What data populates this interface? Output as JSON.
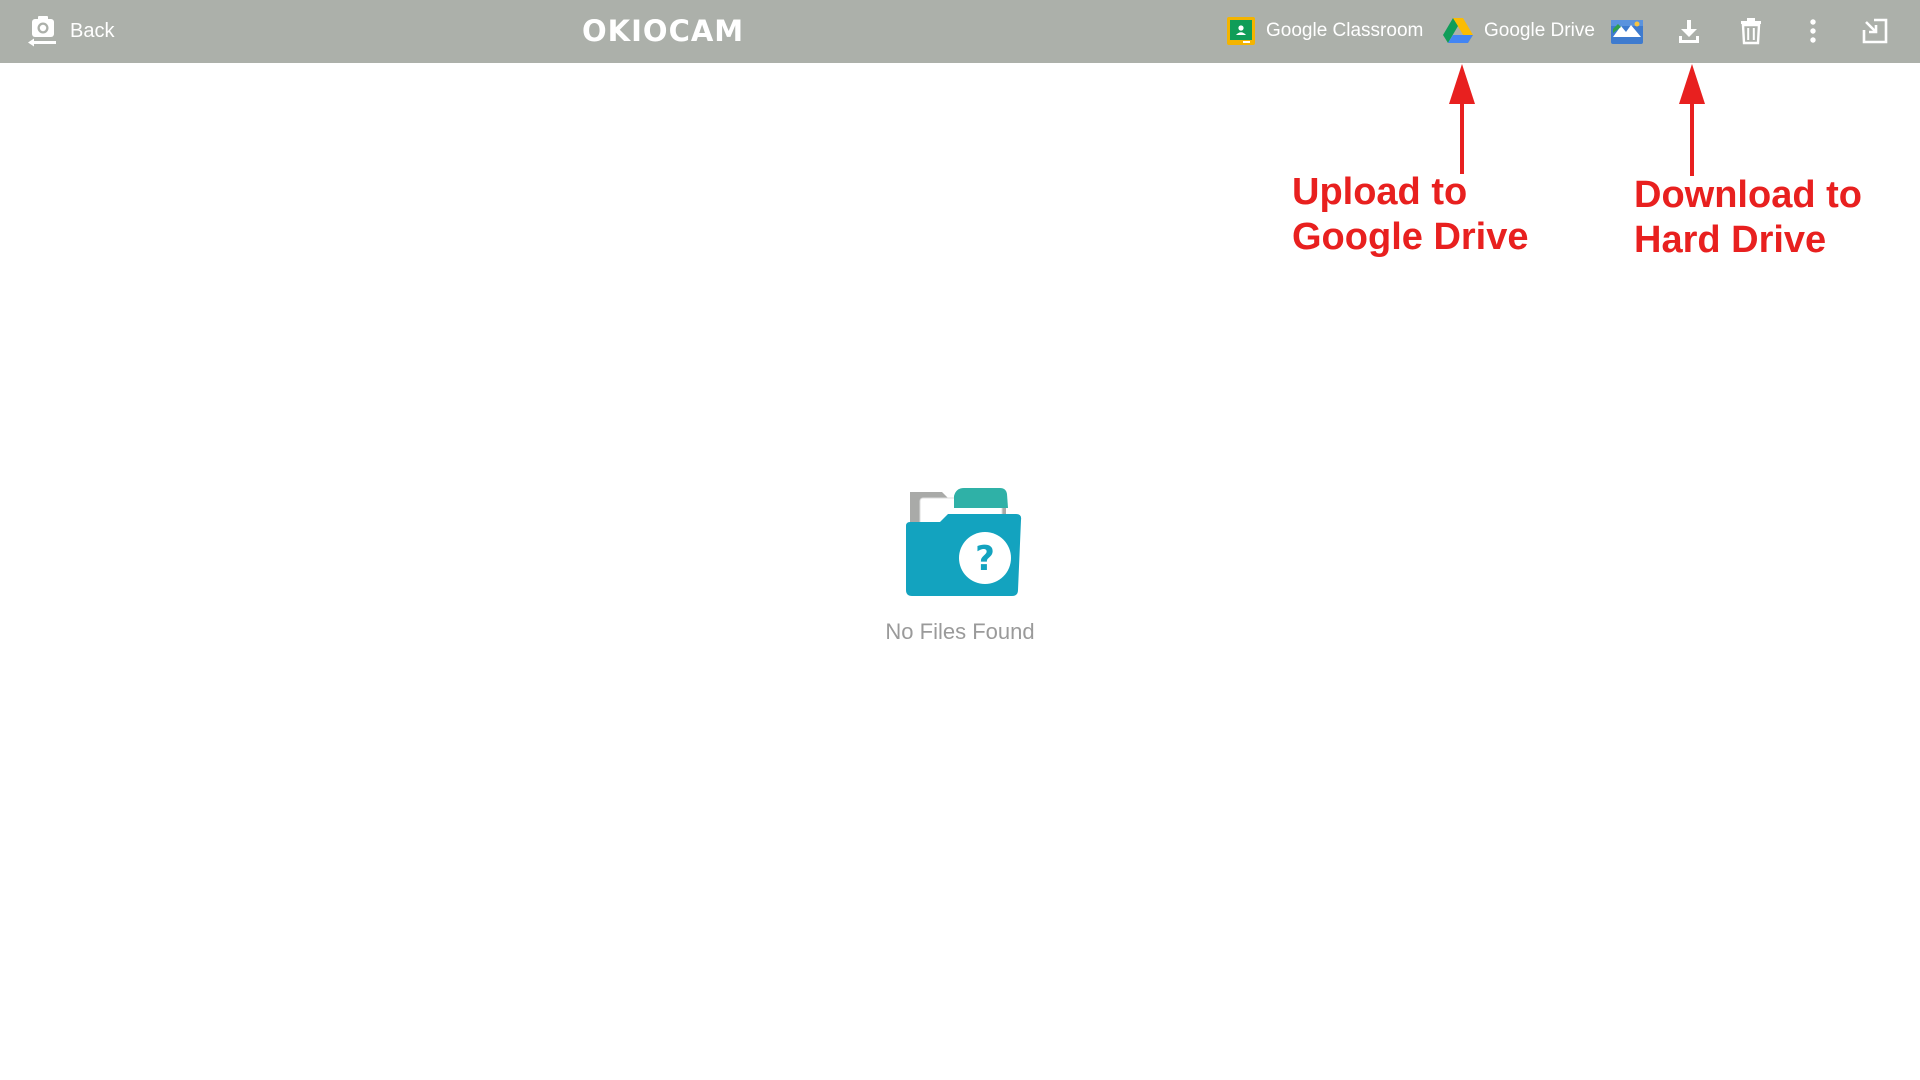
{
  "toolbar": {
    "back_label": "Back",
    "brand": "OKIOCAM",
    "google_classroom_label": "Google Classroom",
    "google_drive_label": "Google Drive",
    "icons": [
      "back-camera-icon",
      "google-classroom-icon",
      "google-drive-icon",
      "image-gallery-icon",
      "download-icon",
      "trash-icon",
      "more-vert-icon",
      "exit-fullscreen-icon"
    ],
    "background_color": "#acb0aa"
  },
  "annotations": {
    "upload": [
      "Upload to",
      "Google Drive"
    ],
    "download": [
      "Download to",
      "Hard Drive"
    ],
    "color": "#e8201f"
  },
  "empty_state": {
    "message": "No Files Found",
    "icon": "folder-question-icon",
    "accent_color": "#13a3bf"
  }
}
